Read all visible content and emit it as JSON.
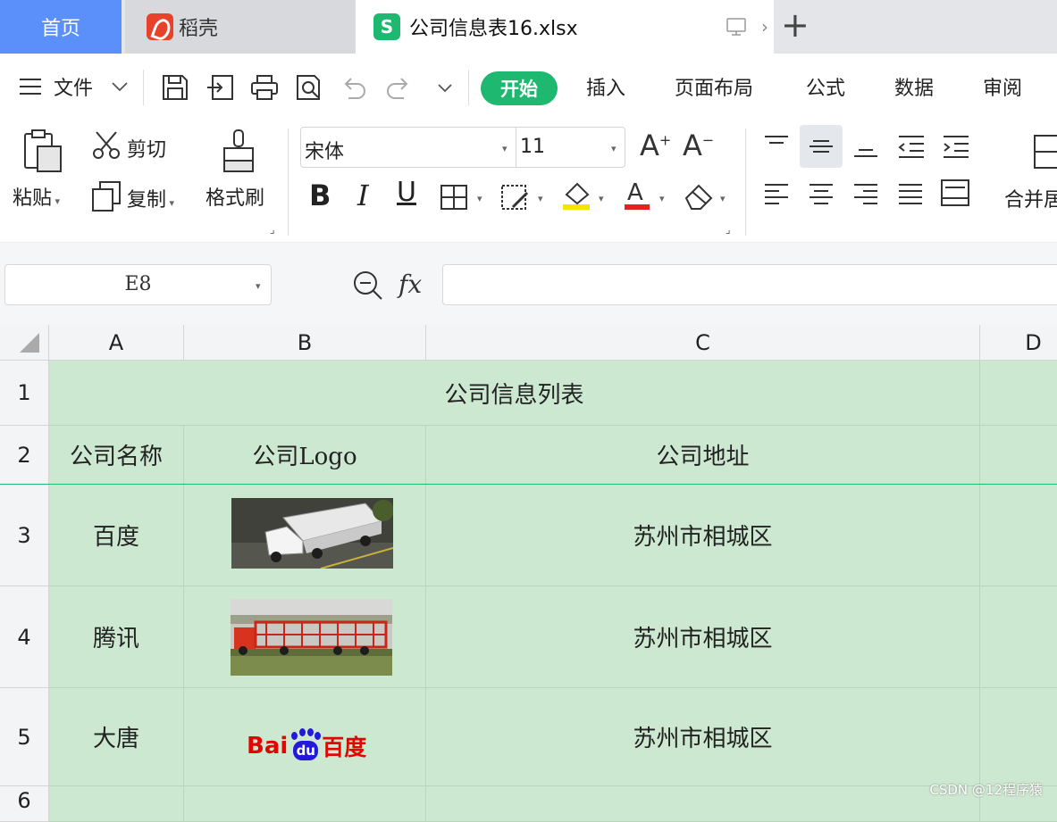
{
  "tabs": {
    "home": "首页",
    "daoke": "稻壳",
    "file": "公司信息表16.xlsx"
  },
  "toolbar": {
    "menu_label": "文件",
    "start": "开始",
    "insert": "插入",
    "page_layout": "页面布局",
    "formula": "公式",
    "data": "数据",
    "review": "审阅"
  },
  "ribbon": {
    "paste": "粘贴",
    "cut": "剪切",
    "copy": "复制",
    "format_painter": "格式刷",
    "font_name": "宋体",
    "font_size": "11",
    "merge": "合并居"
  },
  "formula_bar": {
    "cell_ref": "E8",
    "fx": "fx",
    "value": ""
  },
  "sheet": {
    "columns": [
      "A",
      "B",
      "C",
      "D"
    ],
    "rows": [
      "1",
      "2",
      "3",
      "4",
      "5",
      "6"
    ],
    "title": "公司信息列表",
    "headers": [
      "公司名称",
      "公司Logo",
      "公司地址"
    ],
    "data": [
      {
        "name": "百度",
        "address": "苏州市相城区"
      },
      {
        "name": "腾讯",
        "address": "苏州市相城区"
      },
      {
        "name": "大唐",
        "address": "苏州市相城区"
      }
    ],
    "logo_text_1": "Bai",
    "logo_text_2": "du",
    "logo_text_3": "百度"
  },
  "watermark": "CSDN @12程序猿",
  "colors": {
    "accent": "#1fb871",
    "home_tab": "#5b8ff9",
    "cell_fill": "#cde8d0"
  }
}
